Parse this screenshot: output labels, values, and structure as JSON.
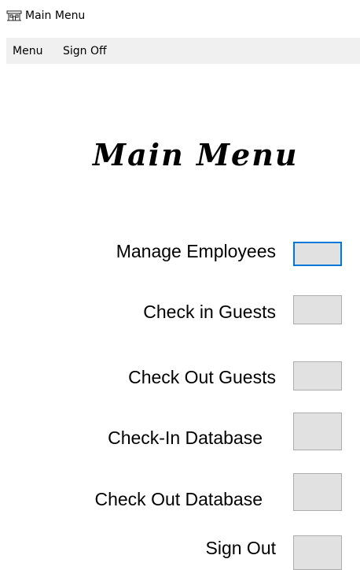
{
  "window": {
    "title": "Main Menu",
    "icon": "hotel-icon"
  },
  "menubar": {
    "items": [
      "Menu",
      "Sign Off"
    ]
  },
  "heading": "Main Menu",
  "rows": [
    {
      "label": "Manage Employees"
    },
    {
      "label": "Check in Guests"
    },
    {
      "label": "Check Out Guests"
    },
    {
      "label": "Check-In Database"
    },
    {
      "label": "Check Out Database"
    },
    {
      "label": "Sign Out"
    }
  ],
  "colors": {
    "focus_border": "#0078d7",
    "button_face": "#e1e1e1",
    "menubar_bg": "#f0f0f0"
  }
}
